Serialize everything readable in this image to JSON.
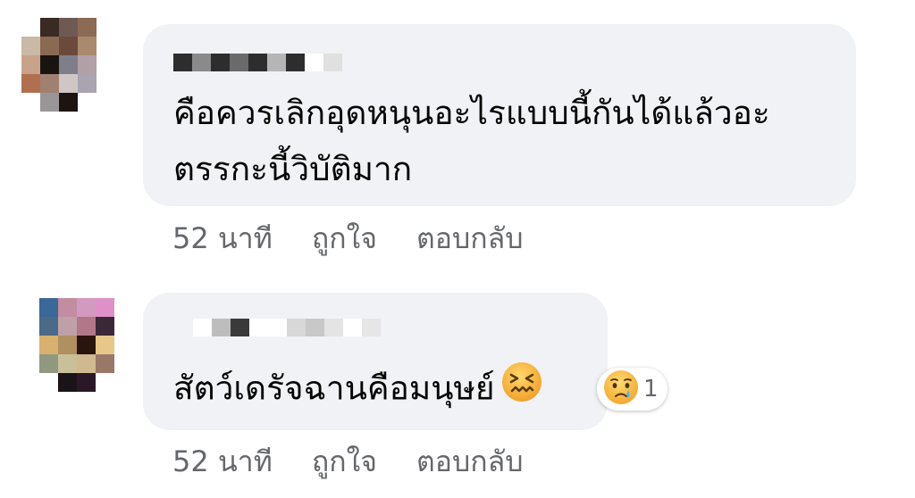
{
  "comments": [
    {
      "text_line1": "คือควรเลิกอุดหนุนอะไรแบบนี้กันได้แล้วอะ",
      "text_line2": "ตรรกะนี้วิบัติมาก",
      "time": "52 นาที",
      "like_label": "ถูกใจ",
      "reply_label": "ตอบกลับ",
      "avatar_colors": [
        "#ffffff",
        "#3a2a24",
        "#6e5a52",
        "#8c6a55",
        "#c9b9a6",
        "#8a6a54",
        "#6b4a3c",
        "#aa8a6f",
        "#c8a38a",
        "#1a1410",
        "#7f7f8a",
        "#b1a0a6",
        "#b07050",
        "#a08070",
        "#d1c6c6",
        "#aaa3b0",
        "#ffffff",
        "#9a9597",
        "#1b1411",
        "#ffffff"
      ],
      "name_colors": [
        "#2d2d2d",
        "#8a8a8a",
        "#2d2d2d",
        "#6a6a6a",
        "#2d2d2d",
        "#b5b5b5",
        "#2d2d2d",
        "#ffffff",
        "#e0e0e0"
      ]
    },
    {
      "text": "สัตว์เดรัจฉานคือมนุษย์",
      "inline_emoji": "confounded-face",
      "reaction_emoji": "sad-tear-face",
      "reaction_count": "1",
      "time": "52 นาที",
      "like_label": "ถูกใจ",
      "reply_label": "ตอบกลับ",
      "avatar_colors": [
        "#3a6898",
        "#c48ca0",
        "#d39ac0",
        "#e090c8",
        "#4a6a88",
        "#c0a0a8",
        "#b07888",
        "#3a2838",
        "#d8b070",
        "#b09060",
        "#2a1410",
        "#e8c88a",
        "#909880",
        "#c8c098",
        "#d0b890",
        "#9a7868",
        "#ffffff",
        "#1a1418",
        "#2a1828",
        "#ffffff"
      ],
      "name_colors": [
        "#ffffff",
        "#bdbdbd",
        "#3a3a3a",
        "#ffffff",
        "#ffffff",
        "#d8d8d8",
        "#c8c8c8",
        "#e4e4e4",
        "#ffffff",
        "#e6e6e6"
      ]
    }
  ]
}
